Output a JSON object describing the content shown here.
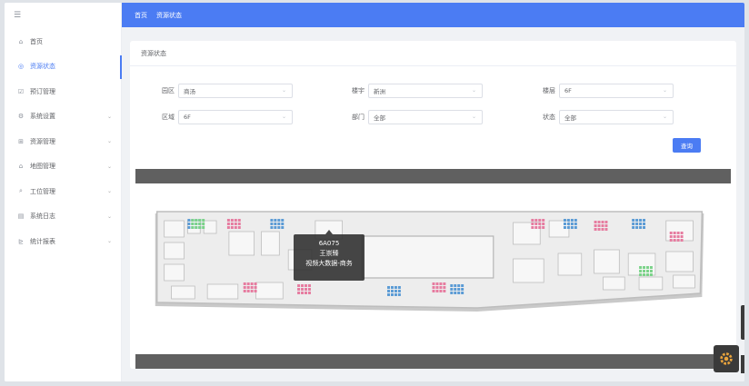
{
  "sidebar": {
    "menu_icon": "☰",
    "items": [
      {
        "label": "首页",
        "icon": "⌂",
        "arrow": "",
        "active": false
      },
      {
        "label": "资源状态",
        "icon": "◎",
        "arrow": "",
        "active": true
      },
      {
        "label": "预订管理",
        "icon": "☑",
        "arrow": "",
        "active": false
      },
      {
        "label": "系统设置",
        "icon": "⚙",
        "arrow": "⌄",
        "active": false
      },
      {
        "label": "资源管理",
        "icon": "⊞",
        "arrow": "⌄",
        "active": false
      },
      {
        "label": "地图管理",
        "icon": "⌂",
        "arrow": "⌄",
        "active": false
      },
      {
        "label": "工位管理",
        "icon": "⌕",
        "arrow": "⌄",
        "active": false
      },
      {
        "label": "系统日志",
        "icon": "▤",
        "arrow": "⌄",
        "active": false
      },
      {
        "label": "统计报表",
        "icon": "⊵",
        "arrow": "⌄",
        "active": false
      }
    ]
  },
  "topbar": {
    "breadcrumb_home": "首页",
    "breadcrumb_current": "资源状态"
  },
  "card": {
    "title": "资源状态"
  },
  "form": {
    "park_label": "园区",
    "park_value": "商汤",
    "building_label": "楼宇",
    "building_value": "新洲",
    "floor_label": "楼层",
    "floor_value": "6F",
    "area_label": "区域",
    "area_value": "6F",
    "dept_label": "部门",
    "dept_value": "全部",
    "status_label": "状态",
    "status_value": "全部",
    "caret": "⌄",
    "query_label": "查询"
  },
  "tooltip": {
    "seat": "6A075",
    "name": "王崇臻",
    "dept": "视频大数据-商务"
  },
  "colors": {
    "accent": "#4b7cf3",
    "dark_bar": "#606060",
    "seat_occupied": "#5b9bd5",
    "seat_reserved": "#e67ca0",
    "seat_free": "#7bd389"
  }
}
